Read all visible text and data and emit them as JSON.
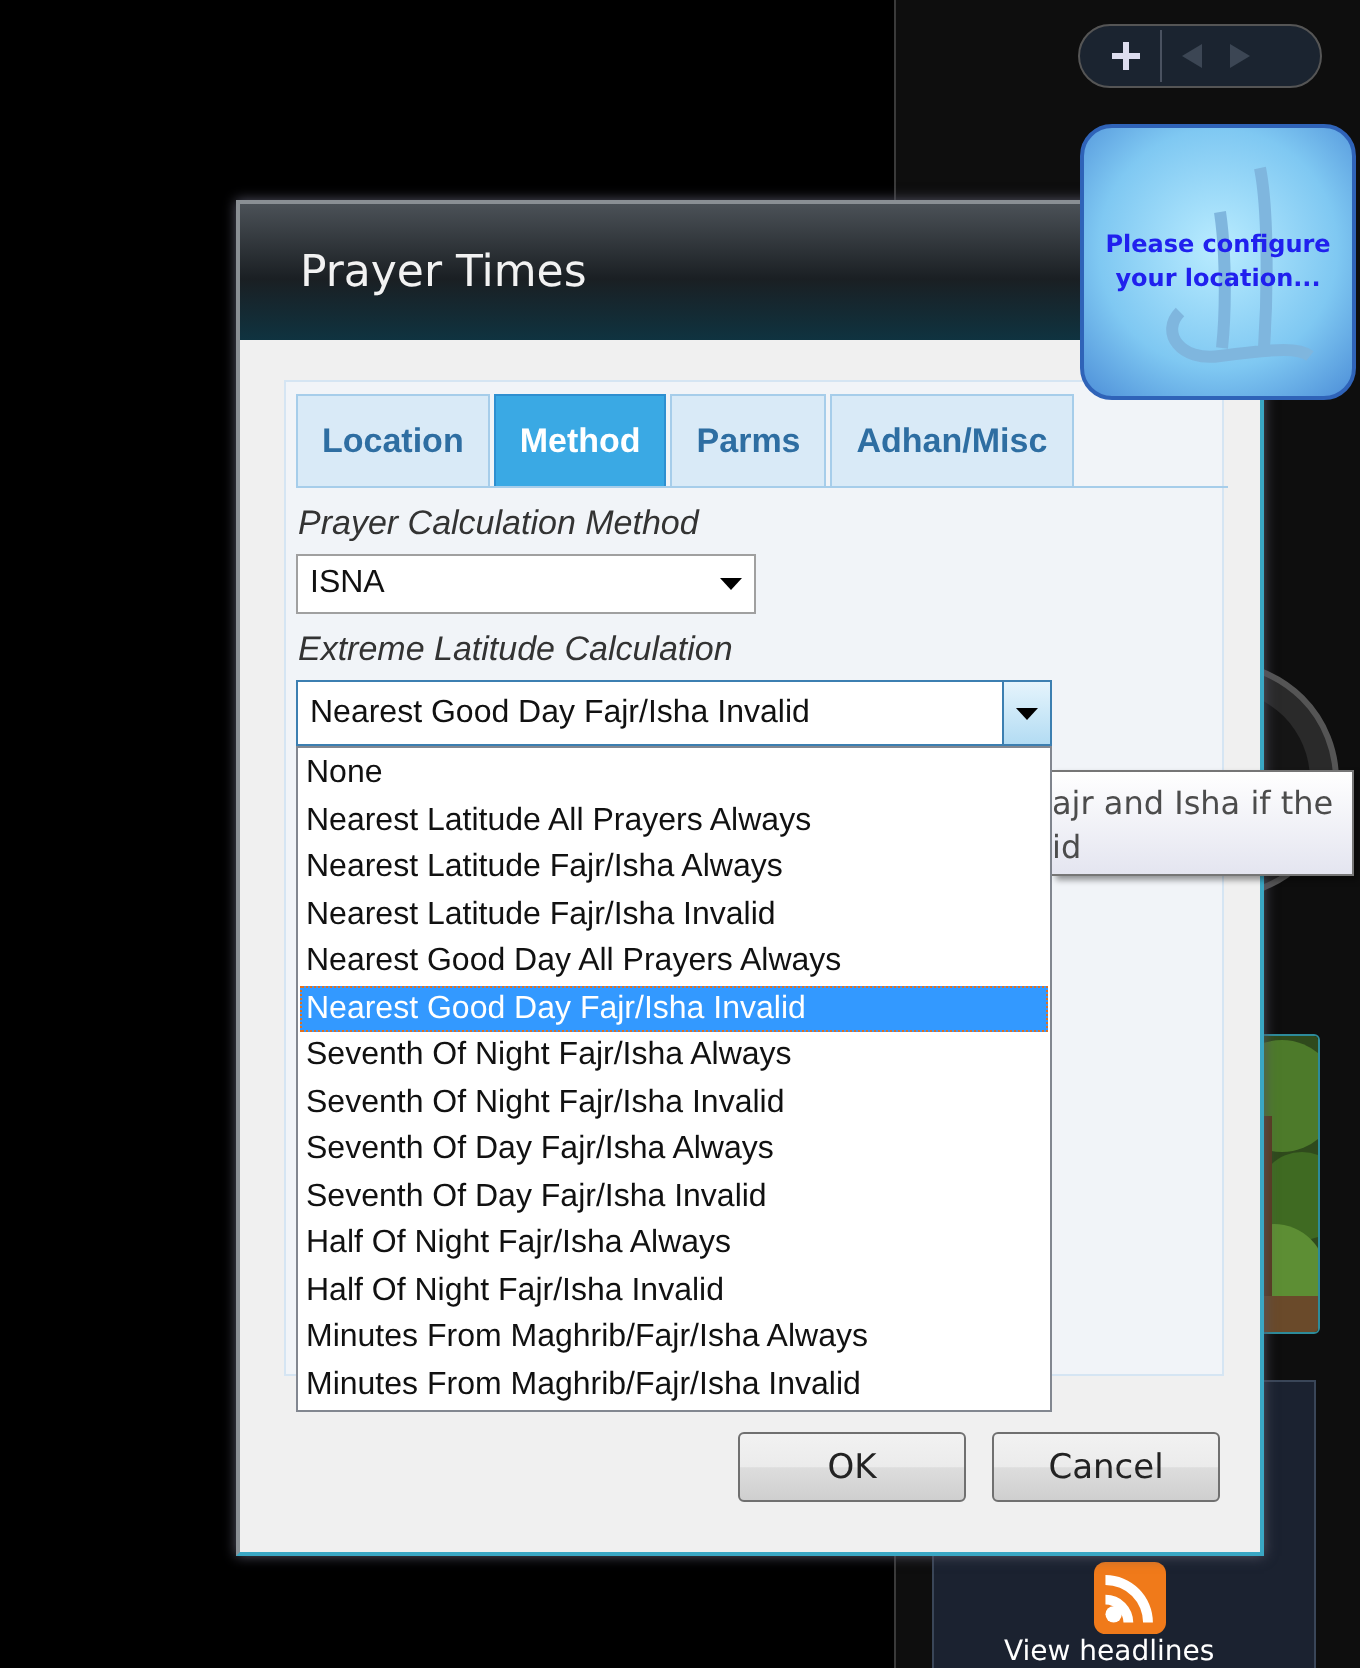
{
  "window": {
    "title": "Prayer Times"
  },
  "tabs": [
    {
      "label": "Location",
      "selected": false
    },
    {
      "label": "Method",
      "selected": true
    },
    {
      "label": "Parms",
      "selected": false
    },
    {
      "label": "Adhan/Misc",
      "selected": false
    }
  ],
  "calculation_method": {
    "label": "Prayer Calculation Method",
    "value": "ISNA"
  },
  "extreme_latitude": {
    "label": "Extreme Latitude Calculation",
    "value": "Nearest Good Day Fajr/Isha Invalid",
    "expanded": true,
    "options": [
      {
        "label": "None",
        "selected": false
      },
      {
        "label": "Nearest Latitude All Prayers Always",
        "selected": false
      },
      {
        "label": "Nearest Latitude Fajr/Isha Always",
        "selected": false
      },
      {
        "label": "Nearest Latitude Fajr/Isha Invalid",
        "selected": false
      },
      {
        "label": "Nearest Good Day All Prayers Always",
        "selected": false
      },
      {
        "label": "Nearest Good Day Fajr/Isha Invalid",
        "selected": true
      },
      {
        "label": "Seventh Of Night Fajr/Isha Always",
        "selected": false
      },
      {
        "label": "Seventh Of Night Fajr/Isha Invalid",
        "selected": false
      },
      {
        "label": "Seventh Of Day Fajr/Isha Always",
        "selected": false
      },
      {
        "label": "Seventh Of Day Fajr/Isha Invalid",
        "selected": false
      },
      {
        "label": "Half Of Night Fajr/Isha Always",
        "selected": false
      },
      {
        "label": "Half Of Night Fajr/Isha Invalid",
        "selected": false
      },
      {
        "label": "Minutes From Maghrib/Fajr/Isha Always",
        "selected": false
      },
      {
        "label": "Minutes From Maghrib/Fajr/Isha Invalid",
        "selected": false
      }
    ]
  },
  "tooltip": {
    "lines": [
      "ajr and Isha if the",
      "id"
    ]
  },
  "buttons": [
    {
      "label": "OK"
    },
    {
      "label": "Cancel"
    }
  ],
  "location_gadget": {
    "message": "Please configure your location..."
  },
  "feed_gadget": {
    "link": "View headlines"
  }
}
